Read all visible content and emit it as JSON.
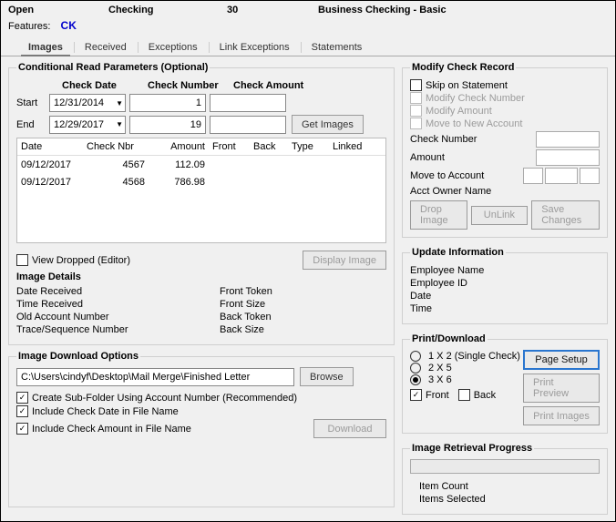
{
  "header": {
    "status": "Open",
    "acctType": "Checking",
    "acctNumber": "30",
    "product": "Business Checking - Basic",
    "featuresLabel": "Features:",
    "feature": "CK"
  },
  "tabs": [
    "Images",
    "Received",
    "Exceptions",
    "Link Exceptions",
    "Statements"
  ],
  "left": {
    "cond": {
      "legend": "Conditional Read Parameters (Optional)",
      "cols": [
        "Check Date",
        "Check Number",
        "Check Amount"
      ],
      "start": "Start",
      "end": "End",
      "startDate": "12/31/2014",
      "endDate": "12/29/2017",
      "startNum": "1",
      "endNum": "19",
      "getImages": "Get Images"
    },
    "grid": {
      "cols": [
        "Date",
        "Check Nbr",
        "Amount",
        "Front",
        "Back",
        "Type",
        "Linked"
      ],
      "rows": [
        {
          "date": "09/12/2017",
          "nbr": "4567",
          "amt": "112.09"
        },
        {
          "date": "09/12/2017",
          "nbr": "4568",
          "amt": "786.98"
        }
      ],
      "viewDropped": "View Dropped (Editor)",
      "displayImage": "Display Image"
    },
    "details": {
      "heading": "Image Details",
      "col1": [
        "Date Received",
        "Time Received",
        "Old Account Number",
        "Trace/Sequence Number"
      ],
      "col2": [
        "Front Token",
        "Front Size",
        "Back Token",
        "Back Size"
      ]
    },
    "dl": {
      "legend": "Image Download Options",
      "path": "C:\\Users\\cindyf\\Desktop\\Mail Merge\\Finished Letter",
      "browse": "Browse",
      "opt1": "Create Sub-Folder Using Account Number (Recommended)",
      "opt2": "Include Check Date in File Name",
      "opt3": "Include Check Amount in File Name",
      "download": "Download"
    }
  },
  "right": {
    "mod": {
      "legend": "Modify Check Record",
      "skip": "Skip on Statement",
      "mnum": "Modify Check Number",
      "mamt": "Modify Amount",
      "move": "Move to New Account",
      "fCheckNum": "Check Number",
      "fAmount": "Amount",
      "fMove": "Move to Account",
      "owner": "Acct Owner Name",
      "bDrop": "Drop Image",
      "bUnlink": "UnLink",
      "bSave": "Save Changes"
    },
    "upd": {
      "legend": "Update Information",
      "ename": "Employee Name",
      "eid": "Employee ID",
      "date": "Date",
      "time": "Time"
    },
    "pd": {
      "legend": "Print/Download",
      "r1": "1 X 2 (Single Check)",
      "r2": "2 X 5",
      "r3": "3 X 6",
      "front": "Front",
      "back": "Back",
      "bPage": "Page Setup",
      "bPrev": "Print Preview",
      "bPrint": "Print Images"
    },
    "prog": {
      "legend": "Image Retrieval Progress",
      "count": "Item Count",
      "selected": "Items Selected"
    }
  }
}
